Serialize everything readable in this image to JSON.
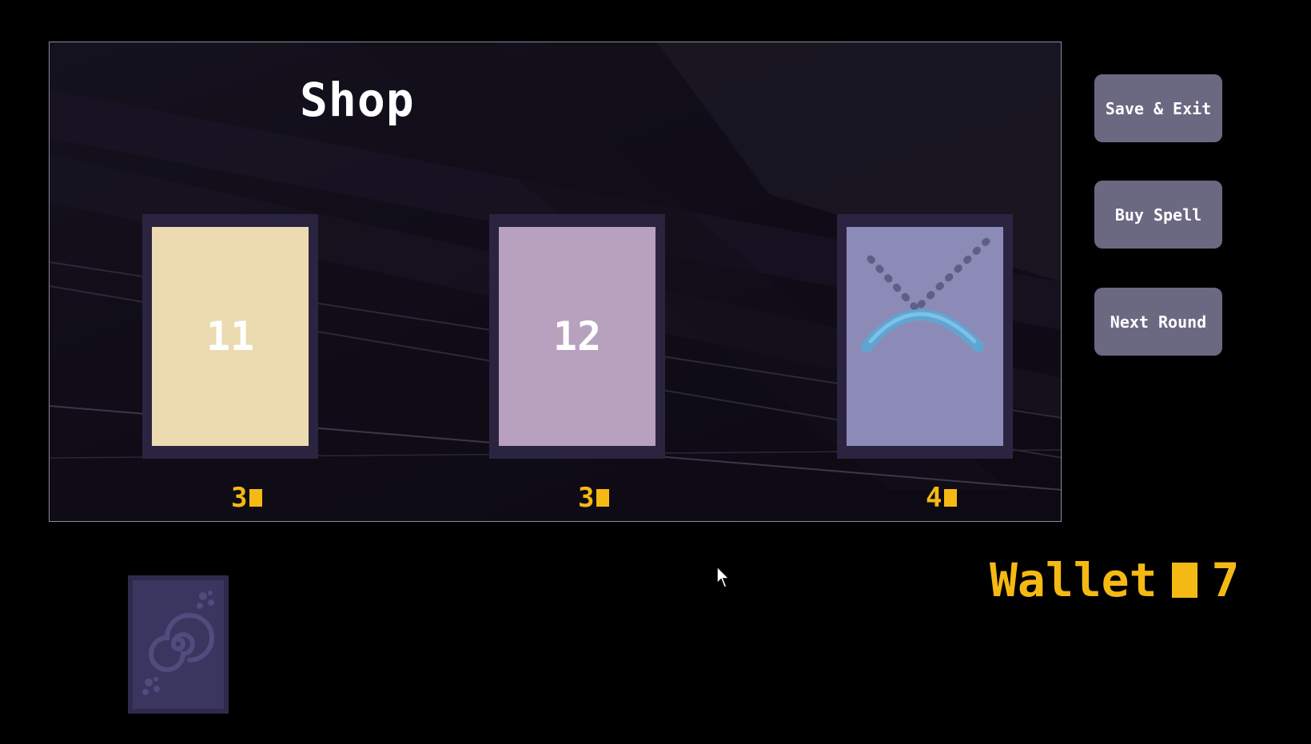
{
  "shop": {
    "title": "Shop",
    "cards": [
      {
        "label": "11",
        "price": "3",
        "color": "#ecdbb0"
      },
      {
        "label": "12",
        "price": "3",
        "color": "#b8a0bf"
      },
      {
        "label": "",
        "icon": "rainbow-arc-icon",
        "price": "4",
        "color": "#8c8bb8"
      }
    ]
  },
  "buttons": {
    "save_exit": "Save & Exit",
    "buy_spell": "Buy Spell",
    "next_round": "Next Round"
  },
  "wallet": {
    "label": "Wallet",
    "amount": "7"
  },
  "deck": {
    "icon": "spiral-deck-icon"
  },
  "colors": {
    "gold": "#f5b914",
    "button": "#6b6882",
    "card_frame": "#2b2440"
  }
}
